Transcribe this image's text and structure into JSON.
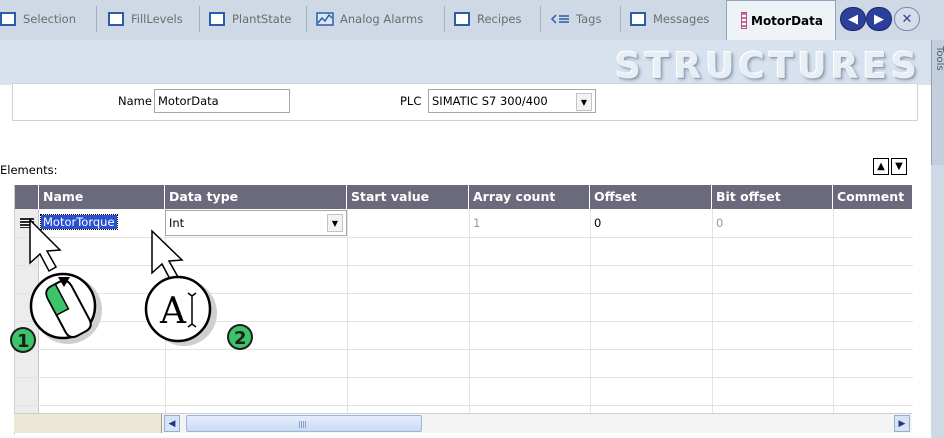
{
  "tabs": [
    {
      "label": "Selection",
      "icon": "window-icon"
    },
    {
      "label": "FillLevels",
      "icon": "window-icon"
    },
    {
      "label": "PlantState",
      "icon": "window-icon"
    },
    {
      "label": "Analog Alarms",
      "icon": "analog-alarm-icon"
    },
    {
      "label": "Recipes",
      "icon": "window-icon"
    },
    {
      "label": "Tags",
      "icon": "tags-icon"
    },
    {
      "label": "Messages",
      "icon": "window-icon"
    }
  ],
  "active_tab": {
    "label": "MotorData",
    "icon": "structure-icon"
  },
  "nav": {
    "prev": "◀",
    "next": "▶",
    "close": "✕"
  },
  "sidebar": {
    "label": "Tools"
  },
  "header": {
    "title": "STRUCTURES"
  },
  "props": {
    "name_label": "Name",
    "name_value": "MotorData",
    "plc_label": "PLC",
    "plc_value": "SIMATIC S7 300/400"
  },
  "elements": {
    "label": "Elements:",
    "columns": [
      "Name",
      "Data type",
      "Start value",
      "Array count",
      "Offset",
      "Bit offset",
      "Comment"
    ],
    "rows": [
      {
        "name": "MotorTorque",
        "data_type": "Int",
        "start_value": "",
        "array_count": "1",
        "offset": "0",
        "bit_offset": "0",
        "comment": ""
      }
    ]
  },
  "annotations": {
    "step1": "1",
    "step2": "2",
    "text_cursor_glyph": "A"
  },
  "colors": {
    "tab_bar": "#cfd9e6",
    "grid_header": "#6a6a7c",
    "selection": "#2a4fd0",
    "annotation_green": "#3cc46a"
  }
}
